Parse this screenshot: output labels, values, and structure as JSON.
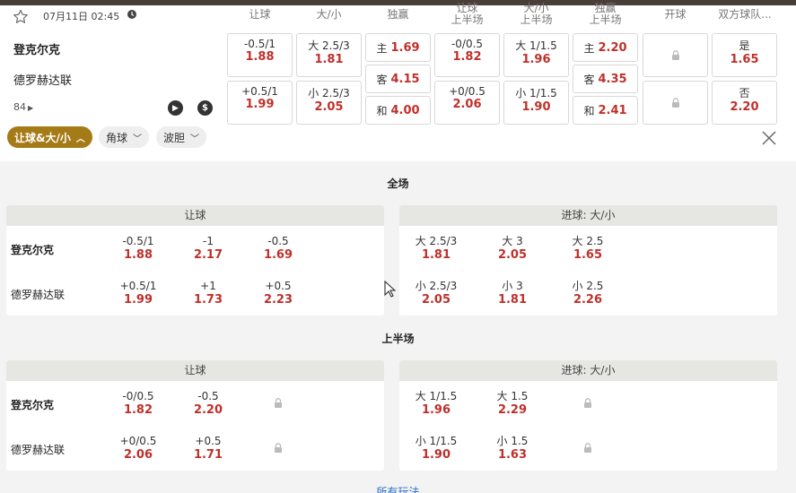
{
  "header": {
    "date_time": "07月11日 02:45",
    "home_team": "登克尔克",
    "away_team": "德罗赫达联",
    "more_count": "84"
  },
  "columns": [
    {
      "label": "让球"
    },
    {
      "label": "大/小"
    },
    {
      "label": "独赢"
    },
    {
      "label": "让球\n上半场"
    },
    {
      "label": "大/小\n上半场"
    },
    {
      "label": "独赢\n上半场"
    },
    {
      "label": "开球"
    },
    {
      "label": "双方球队..."
    }
  ],
  "main_odds": {
    "handicap": [
      {
        "line": "-0.5/1",
        "price": "1.88"
      },
      {
        "line": "+0.5/1",
        "price": "1.99"
      }
    ],
    "over_under": [
      {
        "line": "大 2.5/3",
        "price": "1.81"
      },
      {
        "line": "小 2.5/3",
        "price": "2.05"
      }
    ],
    "moneyline": [
      {
        "label": "主",
        "price": "1.69"
      },
      {
        "label": "客",
        "price": "4.15"
      },
      {
        "label": "和",
        "price": "4.00"
      }
    ],
    "handicap_1h": [
      {
        "line": "-0/0.5",
        "price": "1.82"
      },
      {
        "line": "+0/0.5",
        "price": "2.06"
      }
    ],
    "over_under_1h": [
      {
        "line": "大 1/1.5",
        "price": "1.96"
      },
      {
        "line": "小 1/1.5",
        "price": "1.90"
      }
    ],
    "moneyline_1h": [
      {
        "label": "主",
        "price": "2.20"
      },
      {
        "label": "客",
        "price": "4.35"
      },
      {
        "label": "和",
        "price": "2.41"
      }
    ],
    "both_teams": [
      {
        "line": "是",
        "price": "1.65"
      },
      {
        "line": "否",
        "price": "2.20"
      }
    ]
  },
  "filters": [
    {
      "label": "让球&大/小"
    },
    {
      "label": "角球"
    },
    {
      "label": "波胆"
    }
  ],
  "sections": [
    {
      "title": "全场",
      "handicap_card": {
        "header": "让球",
        "rows": [
          {
            "team": "登克尔克",
            "odds": [
              {
                "line": "-0.5/1",
                "price": "1.88"
              },
              {
                "line": "-1",
                "price": "2.17"
              },
              {
                "line": "-0.5",
                "price": "1.69"
              }
            ]
          },
          {
            "team": "德罗赫达联",
            "odds": [
              {
                "line": "+0.5/1",
                "price": "1.99"
              },
              {
                "line": "+1",
                "price": "1.73"
              },
              {
                "line": "+0.5",
                "price": "2.23"
              }
            ]
          }
        ]
      },
      "goals_card": {
        "header": "进球: 大/小",
        "rows": [
          {
            "odds": [
              {
                "line": "大 2.5/3",
                "price": "1.81"
              },
              {
                "line": "大 3",
                "price": "2.05"
              },
              {
                "line": "大 2.5",
                "price": "1.65"
              }
            ]
          },
          {
            "odds": [
              {
                "line": "小 2.5/3",
                "price": "2.05"
              },
              {
                "line": "小 3",
                "price": "1.81"
              },
              {
                "line": "小 2.5",
                "price": "2.26"
              }
            ]
          }
        ]
      }
    },
    {
      "title": "上半场",
      "handicap_card": {
        "header": "让球",
        "rows": [
          {
            "team": "登克尔克",
            "odds": [
              {
                "line": "-0/0.5",
                "price": "1.82"
              },
              {
                "line": "-0.5",
                "price": "2.20"
              }
            ]
          },
          {
            "team": "德罗赫达联",
            "odds": [
              {
                "line": "+0/0.5",
                "price": "2.06"
              },
              {
                "line": "+0.5",
                "price": "1.71"
              }
            ]
          }
        ]
      },
      "goals_card": {
        "header": "进球: 大/小",
        "rows": [
          {
            "odds": [
              {
                "line": "大 1/1.5",
                "price": "1.96"
              },
              {
                "line": "大 1.5",
                "price": "2.29"
              }
            ]
          },
          {
            "odds": [
              {
                "line": "小 1/1.5",
                "price": "1.90"
              },
              {
                "line": "小 1.5",
                "price": "1.63"
              }
            ]
          }
        ]
      }
    }
  ],
  "footer": {
    "all_plays_label": "所有玩法"
  },
  "colors": {
    "accent": "#a57b17",
    "price": "#c0302a",
    "topbar": "#4a3f38"
  }
}
